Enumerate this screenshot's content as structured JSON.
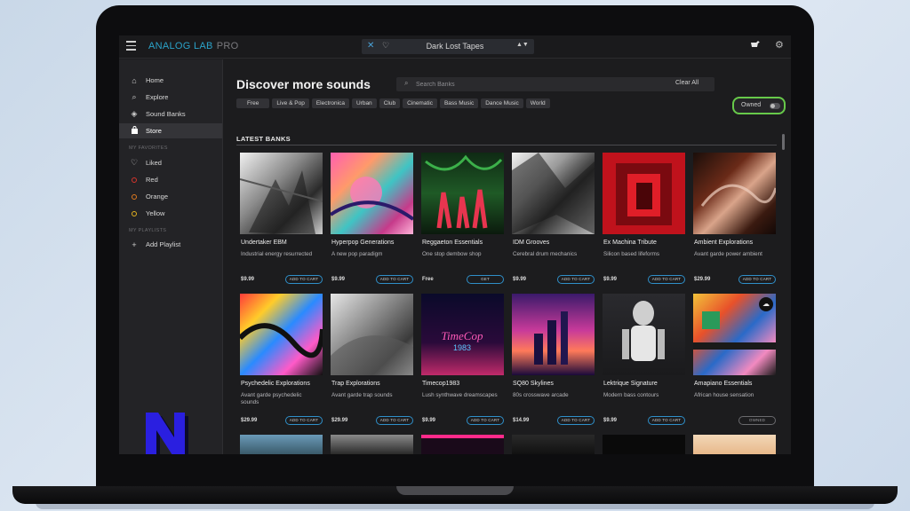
{
  "app": {
    "brand": "ANALOG LAB",
    "brand_suffix": "PRO",
    "preset_name": "Dark Lost Tapes"
  },
  "sidebar": {
    "items": [
      {
        "label": "Home",
        "icon": "home-icon"
      },
      {
        "label": "Explore",
        "icon": "search-icon"
      },
      {
        "label": "Sound Banks",
        "icon": "layers-icon"
      },
      {
        "label": "Store",
        "icon": "bag-icon"
      }
    ],
    "favorites_header": "MY FAVORITES",
    "favorites": [
      {
        "label": "Liked",
        "icon": "heart-icon"
      },
      {
        "label": "Red",
        "color": "#d8342c"
      },
      {
        "label": "Orange",
        "color": "#e07a20"
      },
      {
        "label": "Yellow",
        "color": "#e2b21f"
      }
    ],
    "playlists_header": "MY PLAYLISTS",
    "add_playlist": "Add Playlist"
  },
  "main": {
    "heading": "Discover more sounds",
    "search_placeholder": "Search Banks",
    "clear_all": "Clear All",
    "filters": [
      "Free",
      "Live & Pop",
      "Electronica",
      "Urban",
      "Club",
      "Cinematic",
      "Bass Music",
      "Dance Music",
      "World"
    ],
    "owned_label": "Owned",
    "section_title": "LATEST BANKS",
    "banks": [
      {
        "title": "Undertaker EBM",
        "desc": "Industrial energy resurrected",
        "price": "$9.99",
        "action": "ADD TO CART"
      },
      {
        "title": "Hyperpop Generations",
        "desc": "A new pop paradigm",
        "price": "$9.99",
        "action": "ADD TO CART"
      },
      {
        "title": "Reggaeton Essentials",
        "desc": "One stop dembow shop",
        "price": "Free",
        "action": "GET"
      },
      {
        "title": "IDM Grooves",
        "desc": "Cerebral drum mechanics",
        "price": "$9.99",
        "action": "ADD TO CART"
      },
      {
        "title": "Ex Machina Tribute",
        "desc": "Silicon based lifeforms",
        "price": "$9.99",
        "action": "ADD TO CART"
      },
      {
        "title": "Ambient Explorations",
        "desc": "Avant garde power ambient",
        "price": "$29.99",
        "action": "ADD TO CART"
      },
      {
        "title": "Psychedelic Explorations",
        "desc": "Avant garde psychedelic sounds",
        "price": "$29.99",
        "action": "ADD TO CART"
      },
      {
        "title": "Trap Explorations",
        "desc": "Avant garde trap sounds",
        "price": "$29.99",
        "action": "ADD TO CART"
      },
      {
        "title": "Timecop1983",
        "desc": "Lush synthwave dreamscapes",
        "price": "$9.99",
        "action": "ADD TO CART"
      },
      {
        "title": "SQ80 Skylines",
        "desc": "80s crosswave arcade",
        "price": "$14.99",
        "action": "ADD TO CART"
      },
      {
        "title": "Lektrique Signature",
        "desc": "Modern bass contours",
        "price": "$9.99",
        "action": "ADD TO CART"
      },
      {
        "title": "Amapiano Essentials",
        "desc": "African house sensation",
        "price": "",
        "action": "OWNED"
      }
    ]
  }
}
